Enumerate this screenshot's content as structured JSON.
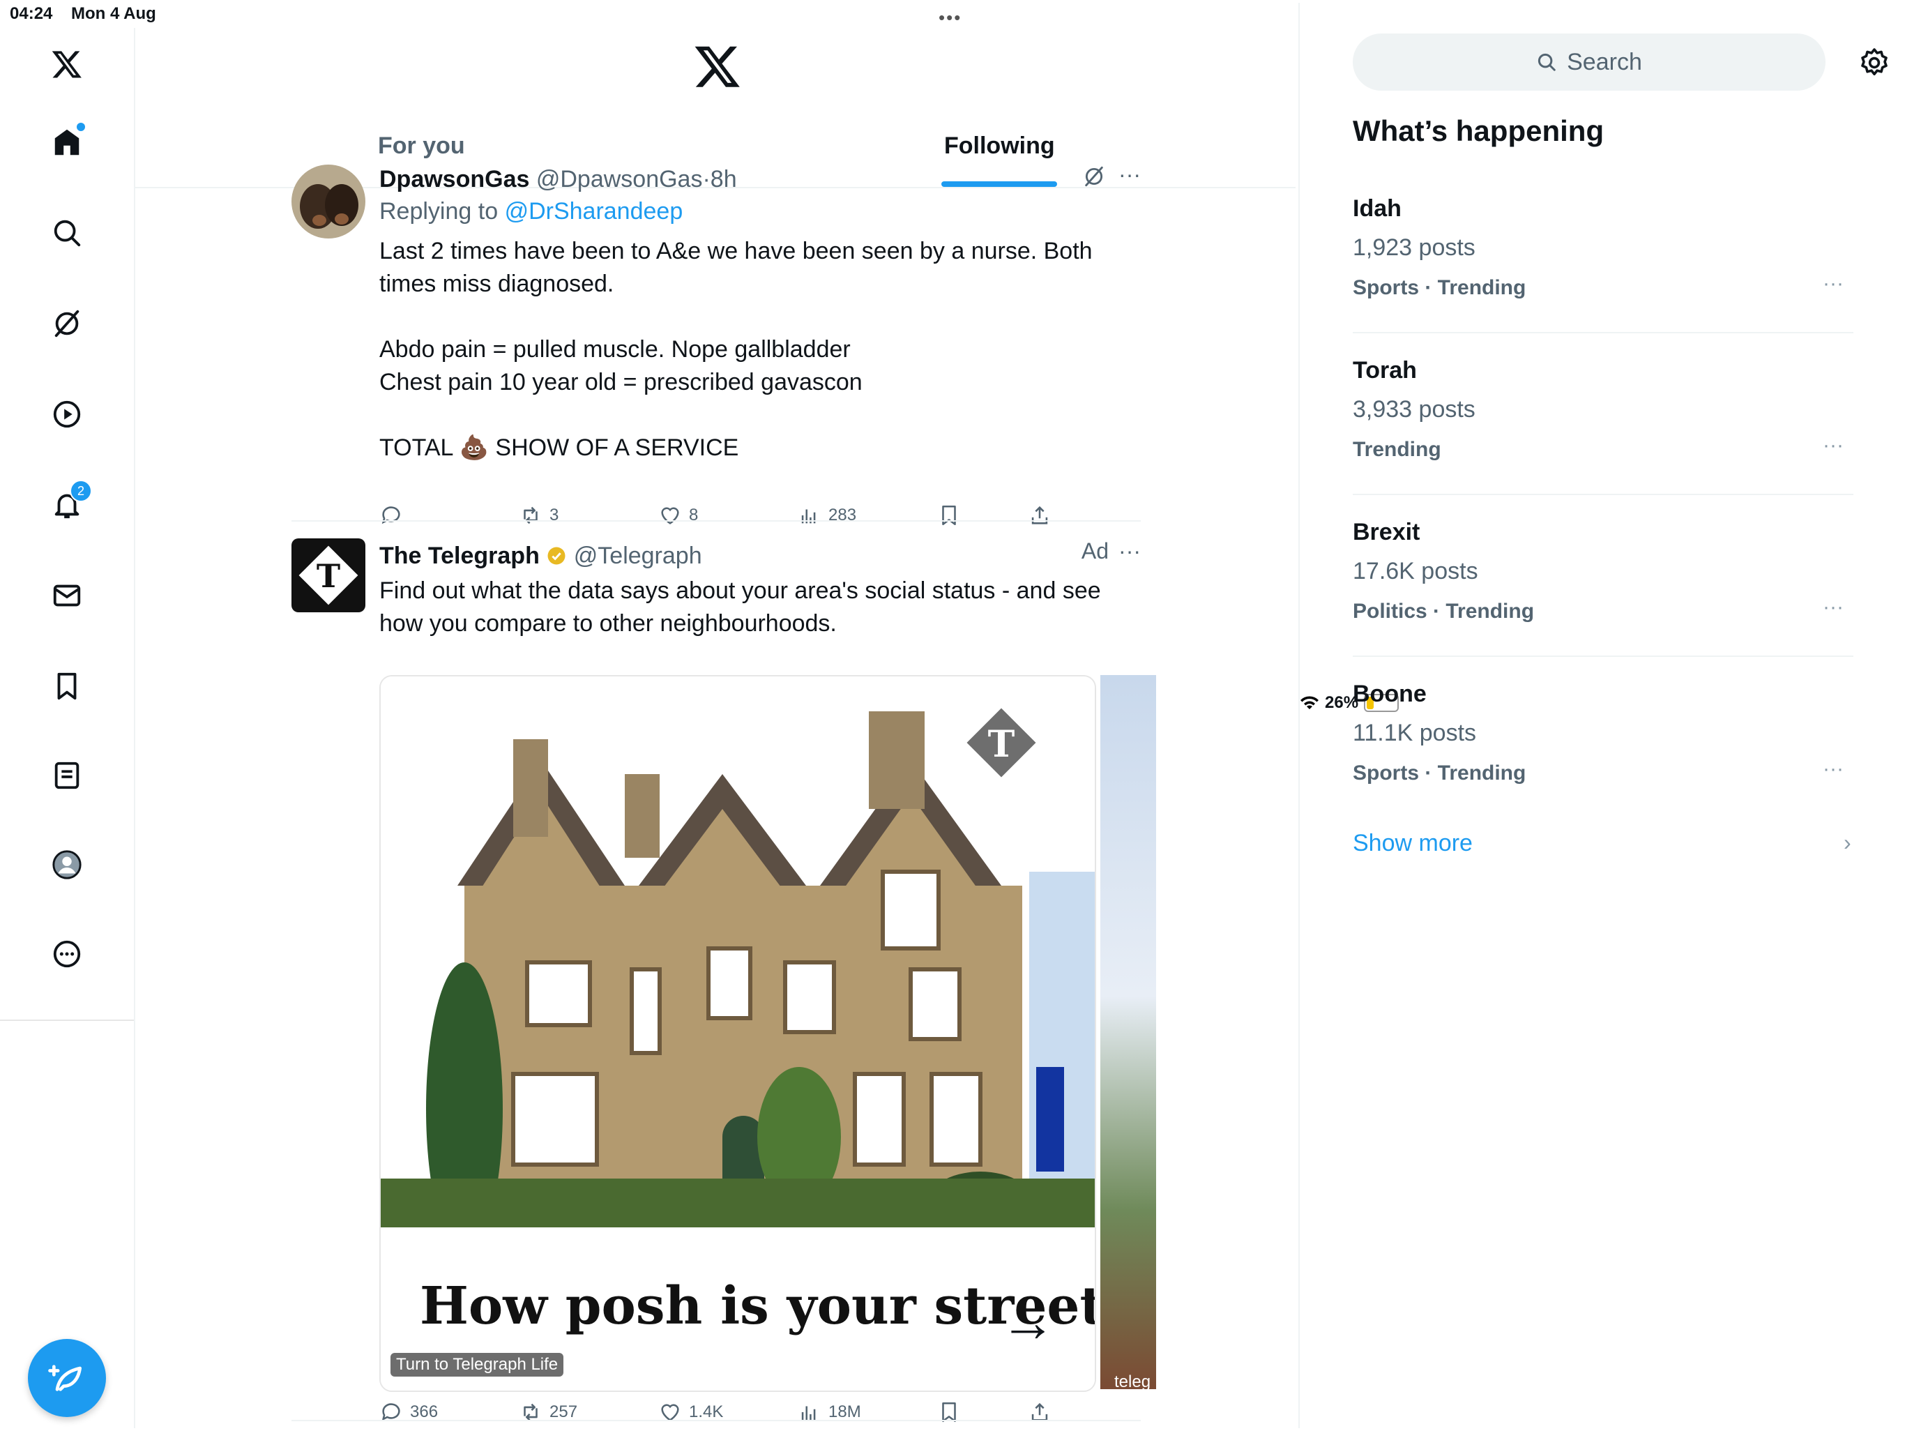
{
  "status_bar": {
    "time": "04:24",
    "date": "Mon 4 Aug",
    "battery": "26%",
    "battery_level": 0.26
  },
  "nav": {
    "notifications_badge": "2",
    "accent": "#1d9bf0"
  },
  "tabs": {
    "for_you": "For you",
    "following": "Following"
  },
  "tweets": [
    {
      "name": "DpawsonGas",
      "handle": "@DpawsonGas",
      "time": "8h",
      "replying_prefix": "Replying to",
      "replying_to": "@DrSharandeep",
      "text": "Last 2 times have been to A&e we have been seen by a nurse. Both\ntimes miss diagnosed.\n\nAbdo pain = pulled muscle. Nope gallbladder\nChest pain 10 year old = prescribed gavascon\n\nTOTAL 💩 SHOW OF A SERVICE",
      "retweets": "3",
      "likes": "8",
      "views": "283"
    },
    {
      "name": "The Telegraph",
      "handle": "@Telegraph",
      "ad": "Ad",
      "text": "Find out what the data says about your area's social status - and see\nhow you compare to other neighbourhoods.",
      "card_title": "How posh is your street?",
      "card_cta": "Turn to Telegraph Life",
      "card2_label": "teleg",
      "replies": "366",
      "retweets": "257",
      "likes": "1.4K",
      "views": "18M"
    }
  ],
  "sidebar": {
    "search_placeholder": "Search",
    "heading": "What’s happening",
    "trends": [
      {
        "topic": "Idah",
        "posts": "1,923 posts",
        "meta": "Sports · Trending"
      },
      {
        "topic": "Torah",
        "posts": "3,933 posts",
        "meta": "Trending"
      },
      {
        "topic": "Brexit",
        "posts": "17.6K posts",
        "meta": "Politics · Trending"
      },
      {
        "topic": "Boone",
        "posts": "11.1K posts",
        "meta": "Sports · Trending"
      }
    ],
    "show_more": "Show more"
  }
}
